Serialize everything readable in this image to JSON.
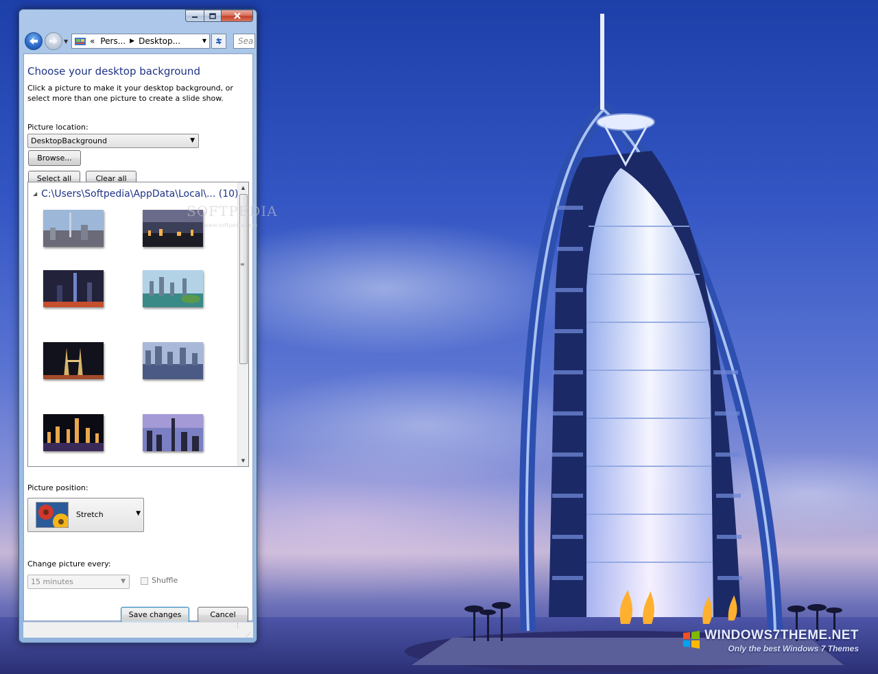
{
  "window": {
    "controls": {
      "minimize": "minimize",
      "maximize": "maximize",
      "close": "close"
    }
  },
  "navbar": {
    "address": {
      "prefix": "«",
      "crumbs": [
        "Pers...",
        "Desktop..."
      ]
    },
    "search_placeholder": "Sea"
  },
  "page": {
    "title": "Choose your desktop background",
    "description": "Click a picture to make it your desktop background, or select more than one picture to create a slide show."
  },
  "picture_location": {
    "label": "Picture location:",
    "value": "DesktopBackground",
    "browse_label": "Browse..."
  },
  "selection": {
    "select_all_label": "Select all",
    "clear_all_label": "Clear all"
  },
  "gallery": {
    "group_label": "C:\\Users\\Softpedia\\AppData\\Local\\... (10)",
    "watermark": "SOFTPEDIA",
    "watermark_sub": "www.softpedia.com",
    "thumbnails": [
      {
        "name": "skyline-day"
      },
      {
        "name": "skyline-dusk"
      },
      {
        "name": "towers-night"
      },
      {
        "name": "harbor-day"
      },
      {
        "name": "twin-towers-night"
      },
      {
        "name": "river-skyline"
      },
      {
        "name": "harbor-night"
      },
      {
        "name": "city-twilight"
      }
    ]
  },
  "picture_position": {
    "label": "Picture position:",
    "value": "Stretch"
  },
  "slideshow": {
    "label": "Change picture every:",
    "interval": "15 minutes",
    "shuffle_label": "Shuffle"
  },
  "footer": {
    "save_label": "Save changes",
    "cancel_label": "Cancel"
  },
  "desktop": {
    "watermark_title": "WINDOWS7THEME.NET",
    "watermark_subtitle": "Only the best Windows 7 Themes",
    "colors": {
      "sky": "#3456c4",
      "title_text": "#1e3287"
    }
  }
}
